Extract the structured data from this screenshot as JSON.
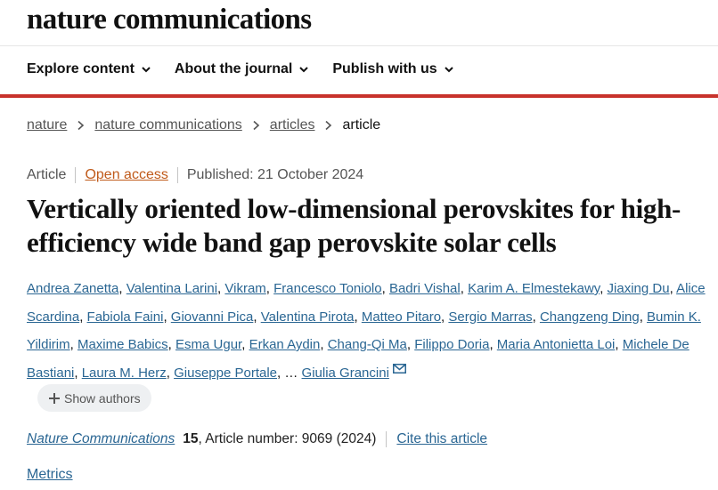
{
  "header": {
    "brand": "nature communications"
  },
  "nav": {
    "items": [
      "Explore content",
      "About the journal",
      "Publish with us"
    ]
  },
  "breadcrumb": {
    "items": [
      "nature",
      "nature communications",
      "articles"
    ],
    "current": "article"
  },
  "article": {
    "type": "Article",
    "access": "Open access",
    "published": "Published: 21 October 2024",
    "title": "Vertically oriented low-dimensional perovskites for high-efficiency wide band gap perovskite solar cells",
    "authors": [
      "Andrea Zanetta",
      "Valentina Larini",
      "Vikram",
      "Francesco Toniolo",
      "Badri Vishal",
      "Karim A. Elmestekawy",
      "Jiaxing Du",
      "Alice Scardina",
      "Fabiola Faini",
      "Giovanni Pica",
      "Valentina Pirota",
      "Matteo Pitaro",
      "Sergio Marras",
      "Changzeng Ding",
      "Bumin K. Yildirim",
      "Maxime Babics",
      "Esma Ugur",
      "Erkan Aydin",
      "Chang-Qi Ma",
      "Filippo Doria",
      "Maria Antonietta Loi",
      "Michele De Bastiani",
      "Laura M. Herz",
      "Giuseppe Portale"
    ],
    "ellipsis": "…",
    "last_author": "Giulia Grancini",
    "show_authors": "Show authors",
    "journal": "Nature Communications",
    "volume": "15",
    "article_number": ", Article number: 9069 (2024)",
    "cite": "Cite this article",
    "metrics": "Metrics"
  },
  "colors": {
    "accent_red": "#c8322b",
    "link_blue": "#2a6693",
    "open_access_orange": "#c05a1a"
  }
}
